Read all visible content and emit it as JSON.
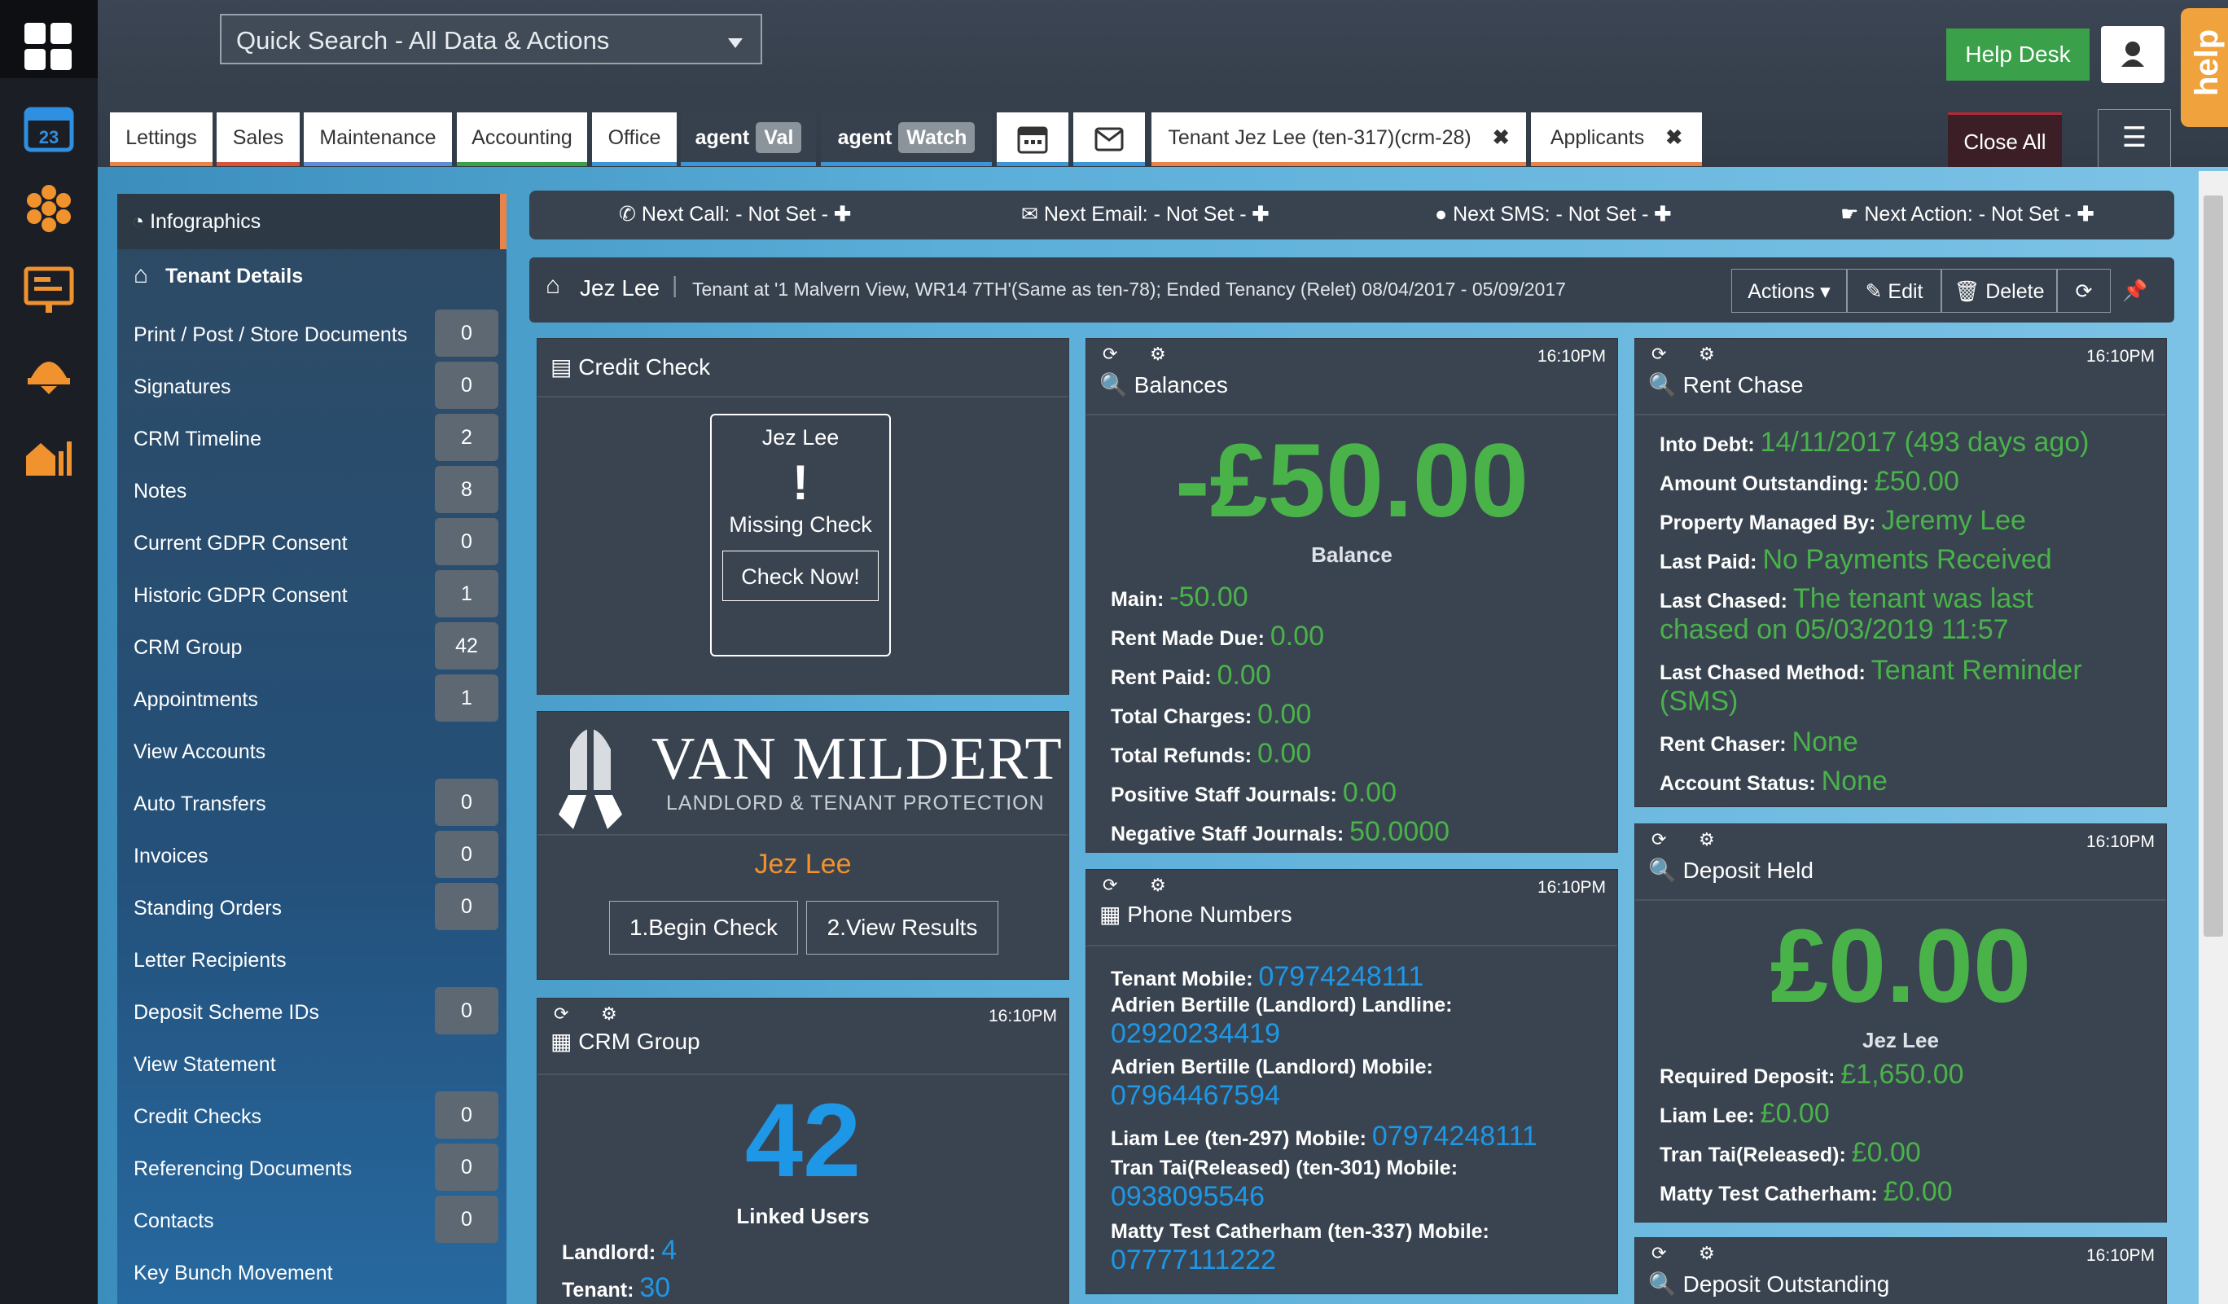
{
  "search": {
    "placeholder": "Quick Search - All Data & Actions"
  },
  "tabs": [
    {
      "label": "Lettings"
    },
    {
      "label": "Sales"
    },
    {
      "label": "Maintenance"
    },
    {
      "label": "Accounting"
    },
    {
      "label": "Office"
    },
    {
      "label": "agent",
      "pill": "Val"
    },
    {
      "label": "agent",
      "pill": "Watch"
    },
    {
      "label": "Tenant Jez Lee (ten-317)(crm-28)"
    },
    {
      "label": "Applicants"
    }
  ],
  "help_desk": "Help Desk",
  "help_tab": "help",
  "close_all": "Close All",
  "sidebar": {
    "header_infographics": "Infographics",
    "header_tenant": "Tenant Details",
    "items": [
      {
        "label": "Print / Post / Store Documents",
        "count": "0"
      },
      {
        "label": "Signatures",
        "count": "0"
      },
      {
        "label": "CRM Timeline",
        "count": "2"
      },
      {
        "label": "Notes",
        "count": "8"
      },
      {
        "label": "Current GDPR Consent",
        "count": "0"
      },
      {
        "label": "Historic GDPR Consent",
        "count": "1"
      },
      {
        "label": "CRM Group",
        "count": "42"
      },
      {
        "label": "Appointments",
        "count": "1"
      },
      {
        "label": "View Accounts",
        "count": ""
      },
      {
        "label": "Auto Transfers",
        "count": "0"
      },
      {
        "label": "Invoices",
        "count": "0"
      },
      {
        "label": "Standing Orders",
        "count": "0"
      },
      {
        "label": "Letter Recipients",
        "count": ""
      },
      {
        "label": "Deposit Scheme IDs",
        "count": "0"
      },
      {
        "label": "View Statement",
        "count": ""
      },
      {
        "label": "Credit Checks",
        "count": "0"
      },
      {
        "label": "Referencing Documents",
        "count": "0"
      },
      {
        "label": "Contacts",
        "count": "0"
      },
      {
        "label": "Key Bunch Movement",
        "count": ""
      }
    ]
  },
  "next": {
    "call": "Next Call: - Not Set -",
    "email": "Next Email: - Not Set -",
    "sms": "Next SMS: - Not Set -",
    "action": "Next Action: - Not Set -"
  },
  "tenant": {
    "name": "Jez Lee",
    "desc": "Tenant at '1 Malvern View, WR14 7TH'(Same as ten-78); Ended Tenancy (Relet) 08/04/2017 - 05/09/2017",
    "actions": "Actions",
    "edit": "Edit",
    "delete": "Delete"
  },
  "credit_check": {
    "title": "Credit Check",
    "name": "Jez Lee",
    "mark": "!",
    "status": "Missing Check",
    "button": "Check Now!"
  },
  "van_mildert": {
    "brand": "VAN MILDERT",
    "tagline": "LANDLORD & TENANT PROTECTION",
    "name": "Jez Lee",
    "begin": "1.Begin Check",
    "view": "2.View Results"
  },
  "crm_group": {
    "title": "CRM Group",
    "time": "16:10PM",
    "count": "42",
    "caption": "Linked Users",
    "landlord_label": "Landlord:",
    "landlord": "4",
    "tenant_label": "Tenant:",
    "tenant": "30"
  },
  "balances": {
    "title": "Balances",
    "time": "16:10PM",
    "big": "-£50.00",
    "caption": "Balance",
    "rows": [
      {
        "label": "Main:",
        "value": "-50.00"
      },
      {
        "label": "Rent Made Due:",
        "value": "0.00"
      },
      {
        "label": "Rent Paid:",
        "value": "0.00"
      },
      {
        "label": "Total Charges:",
        "value": "0.00"
      },
      {
        "label": "Total Refunds:",
        "value": "0.00"
      },
      {
        "label": "Positive Staff Journals:",
        "value": "0.00"
      },
      {
        "label": "Negative Staff Journals:",
        "value": "50.0000"
      }
    ]
  },
  "phones": {
    "title": "Phone Numbers",
    "time": "16:10PM",
    "tenant_mobile_label": "Tenant Mobile:",
    "tenant_mobile": "07974248111",
    "ab_landline_label": "Adrien Bertille (Landlord) Landline:",
    "ab_landline": "02920234419",
    "ab_mobile_label": "Adrien Bertille (Landlord) Mobile:",
    "ab_mobile": "07964467594",
    "liam_label": "Liam Lee (ten-297) Mobile:",
    "liam": "07974248111",
    "tran_label": "Tran Tai(Released) (ten-301) Mobile:",
    "tran": "0938095546",
    "matty_label": "Matty Test Catherham (ten-337) Mobile:",
    "matty": "07777111222"
  },
  "rent_chase": {
    "title": "Rent Chase",
    "time": "16:10PM",
    "into_debt_label": "Into Debt:",
    "into_debt": "14/11/2017 (493 days ago)",
    "outstanding_label": "Amount Outstanding:",
    "outstanding": "£50.00",
    "managed_label": "Property Managed By:",
    "managed": "Jeremy Lee",
    "last_paid_label": "Last Paid:",
    "last_paid": "No Payments Received",
    "last_chased_label": "Last Chased:",
    "last_chased_1": "The tenant was last",
    "last_chased_2": "chased on 05/03/2019 11:57",
    "method_label": "Last Chased Method:",
    "method_1": "Tenant Reminder",
    "method_2": "(SMS)",
    "chaser_label": "Rent Chaser:",
    "chaser": "None",
    "status_label": "Account Status:",
    "status": "None"
  },
  "deposit_held": {
    "title": "Deposit Held",
    "time": "16:10PM",
    "big": "£0.00",
    "name": "Jez Lee",
    "required_label": "Required Deposit:",
    "required": "£1,650.00",
    "liam_label": "Liam Lee:",
    "liam": "£0.00",
    "tran_label": "Tran Tai(Released):",
    "tran": "£0.00",
    "matty_label": "Matty Test Catherham:",
    "matty": "£0.00"
  },
  "deposit_outstanding": {
    "title": "Deposit Outstanding",
    "time": "16:10PM"
  },
  "colors": {
    "green": "#49b34a",
    "blue": "#1e97e6",
    "orange": "#f0a23c",
    "helpdesk": "#3aa14a"
  }
}
